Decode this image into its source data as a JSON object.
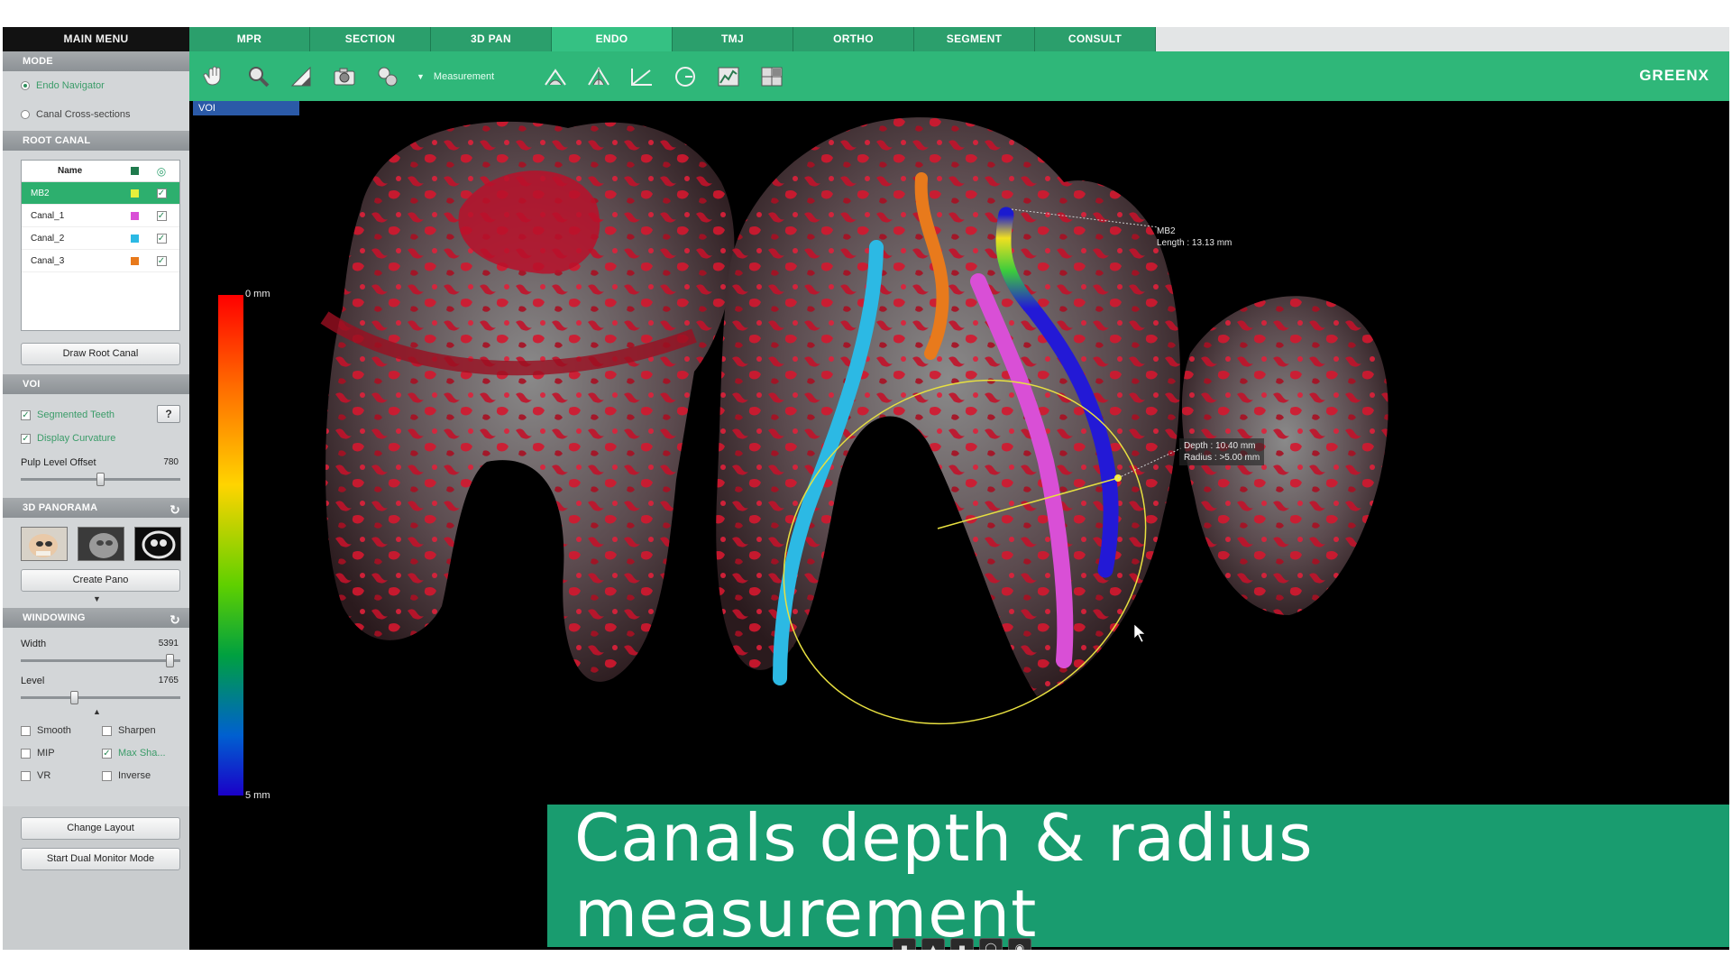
{
  "sidebar": {
    "main_menu": "MAIN MENU",
    "mode": {
      "title": "MODE",
      "options": [
        {
          "label": "Endo Navigator",
          "selected": true
        },
        {
          "label": "Canal Cross-sections",
          "selected": false
        }
      ]
    },
    "root_canal": {
      "title": "ROOT CANAL",
      "header_name": "Name",
      "rows": [
        {
          "name": "MB2",
          "color": "#e6f03c",
          "checked": true,
          "selected": true
        },
        {
          "name": "Canal_1",
          "color": "#d94fd6",
          "checked": true,
          "selected": false
        },
        {
          "name": "Canal_2",
          "color": "#2cb9e4",
          "checked": true,
          "selected": false
        },
        {
          "name": "Canal_3",
          "color": "#e87a1c",
          "checked": true,
          "selected": false
        }
      ],
      "draw_button": "Draw Root Canal"
    },
    "voi": {
      "title": "VOI",
      "segmented_teeth": "Segmented Teeth",
      "display_curvature": "Display Curvature",
      "help": "?",
      "pulp_label": "Pulp Level Offset",
      "pulp_value": "780",
      "pulp_level": 0.5
    },
    "panorama": {
      "title": "3D PANORAMA",
      "create_button": "Create Pano"
    },
    "windowing": {
      "title": "WINDOWING",
      "width_label": "Width",
      "width_value": "5391",
      "width_level": 0.96,
      "level_label": "Level",
      "level_value": "1765",
      "level_level": 0.33,
      "options": [
        {
          "label": "Smooth",
          "checked": false
        },
        {
          "label": "Sharpen",
          "checked": false
        },
        {
          "label": "MIP",
          "checked": false
        },
        {
          "label": "Max Sha...",
          "checked": true
        },
        {
          "label": "VR",
          "checked": false
        },
        {
          "label": "Inverse",
          "checked": false
        }
      ]
    },
    "change_layout": "Change Layout",
    "dual_monitor": "Start Dual Monitor Mode"
  },
  "tabs": [
    "MPR",
    "SECTION",
    "3D PAN",
    "ENDO",
    "TMJ",
    "ORTHO",
    "SEGMENT",
    "CONSULT"
  ],
  "active_tab": "ENDO",
  "toolbar": {
    "measurement": "Measurement",
    "brand": "GREENX"
  },
  "viewport": {
    "voi_tag": "VOI",
    "colorbar_top": "0 mm",
    "colorbar_bottom": "5 mm",
    "annotation_name": "MB2",
    "annotation_length": "Length : 13.13 mm",
    "annotation_depth": "Depth : 10.40 mm",
    "annotation_radius": "Radius : >5.00 mm"
  },
  "banner": "Canals depth & radius measurement"
}
